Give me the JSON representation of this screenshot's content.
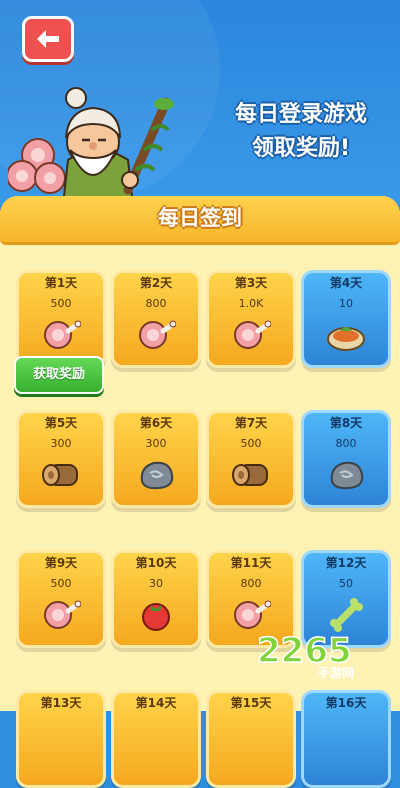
{
  "header": {
    "back_icon": "arrow-left-icon",
    "banner_line1": "每日登录游戏",
    "banner_line2": "领取奖励!"
  },
  "panel": {
    "title": "每日签到",
    "claim_label": "获取奖励"
  },
  "days": [
    {
      "label": "第1天",
      "amount": "500",
      "item": "meat",
      "style": "gold"
    },
    {
      "label": "第2天",
      "amount": "800",
      "item": "meat",
      "style": "gold"
    },
    {
      "label": "第3天",
      "amount": "1.0K",
      "item": "meat",
      "style": "gold"
    },
    {
      "label": "第4天",
      "amount": "10",
      "item": "stew-bowl",
      "style": "blue"
    },
    {
      "label": "第5天",
      "amount": "300",
      "item": "wood-log",
      "style": "gold"
    },
    {
      "label": "第6天",
      "amount": "300",
      "item": "stone",
      "style": "gold"
    },
    {
      "label": "第7天",
      "amount": "500",
      "item": "wood-log",
      "style": "gold"
    },
    {
      "label": "第8天",
      "amount": "800",
      "item": "stone",
      "style": "blue"
    },
    {
      "label": "第9天",
      "amount": "500",
      "item": "meat",
      "style": "gold"
    },
    {
      "label": "第10天",
      "amount": "30",
      "item": "tomato",
      "style": "gold"
    },
    {
      "label": "第11天",
      "amount": "800",
      "item": "meat",
      "style": "gold"
    },
    {
      "label": "第12天",
      "amount": "50",
      "item": "bone",
      "style": "blue"
    },
    {
      "label": "第13天",
      "amount": "",
      "item": "",
      "style": "gold"
    },
    {
      "label": "第14天",
      "amount": "",
      "item": "",
      "style": "gold"
    },
    {
      "label": "第15天",
      "amount": "",
      "item": "",
      "style": "gold"
    },
    {
      "label": "第16天",
      "amount": "",
      "item": "",
      "style": "blue"
    }
  ],
  "watermark": {
    "logo": "2265",
    "text": "手游网"
  },
  "colors": {
    "gold": "#f5a81f",
    "blue": "#2e84d6",
    "claim": "#35b02e",
    "back": "#ef5151"
  }
}
